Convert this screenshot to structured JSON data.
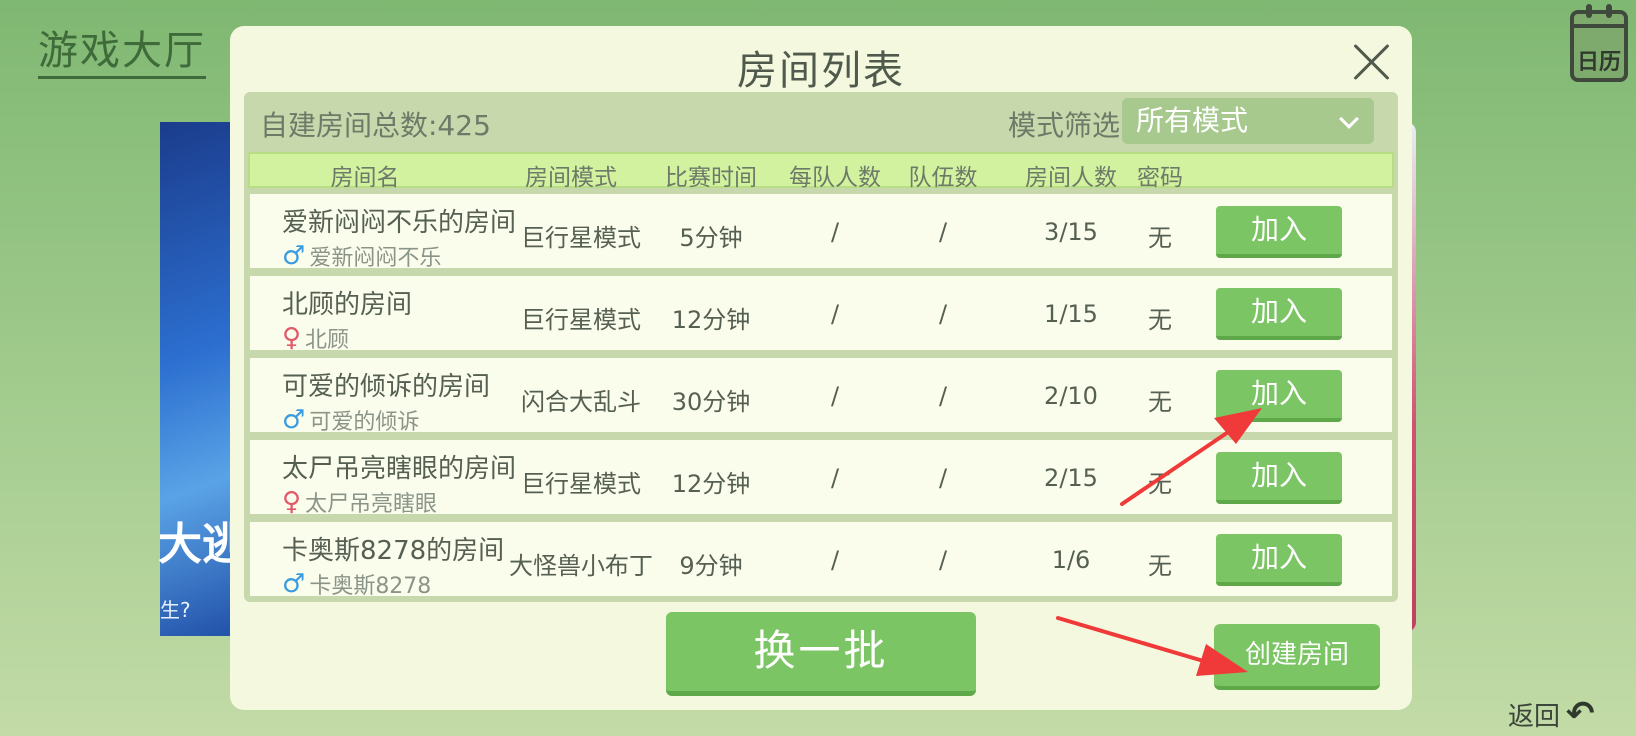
{
  "lobby": {
    "title": "游戏大厅",
    "calendar_label": "日历",
    "banner_text": "大逃",
    "banner_sub": "生?",
    "back_label": "返回"
  },
  "dialog": {
    "title": "房间列表",
    "room_total": "自建房间总数:425",
    "filter_label": "模式筛选:",
    "filter_value": "所有模式",
    "columns": {
      "name": "房间名",
      "mode": "房间模式",
      "time": "比赛时间",
      "per_team": "每队人数",
      "teams": "队伍数",
      "players": "房间人数",
      "password": "密码"
    },
    "rooms": [
      {
        "name": "爱新闷闷不乐的房间",
        "owner": "爱新闷闷不乐",
        "gender": "male",
        "gender_icon": "♂",
        "mode": "巨行星模式",
        "time": "5分钟",
        "per_team": "/",
        "teams": "/",
        "players": "3/15",
        "password": "无",
        "join": "加入"
      },
      {
        "name": "北顾的房间",
        "owner": "北顾",
        "gender": "female",
        "gender_icon": "♀",
        "mode": "巨行星模式",
        "time": "12分钟",
        "per_team": "/",
        "teams": "/",
        "players": "1/15",
        "password": "无",
        "join": "加入"
      },
      {
        "name": "可爱的倾诉的房间",
        "owner": "可爱的倾诉",
        "gender": "male",
        "gender_icon": "♂",
        "mode": "闪合大乱斗",
        "time": "30分钟",
        "per_team": "/",
        "teams": "/",
        "players": "2/10",
        "password": "无",
        "join": "加入"
      },
      {
        "name": "太尸吊亮瞎眼的房间",
        "owner": "太尸吊亮瞎眼",
        "gender": "female",
        "gender_icon": "♀",
        "mode": "巨行星模式",
        "time": "12分钟",
        "per_team": "/",
        "teams": "/",
        "players": "2/15",
        "password": "无",
        "join": "加入"
      },
      {
        "name": "卡奥斯8278的房间",
        "owner": "卡奥斯8278",
        "gender": "male",
        "gender_icon": "♂",
        "mode": "大怪兽小布丁",
        "time": "9分钟",
        "per_team": "/",
        "teams": "/",
        "players": "1/6",
        "password": "无",
        "join": "加入"
      }
    ],
    "refresh_label": "换一批",
    "create_label": "创建房间"
  },
  "colors": {
    "accent_green": "#7cc565",
    "dialog_bg": "#f4f8de",
    "annotation_red": "#f03a3a"
  }
}
